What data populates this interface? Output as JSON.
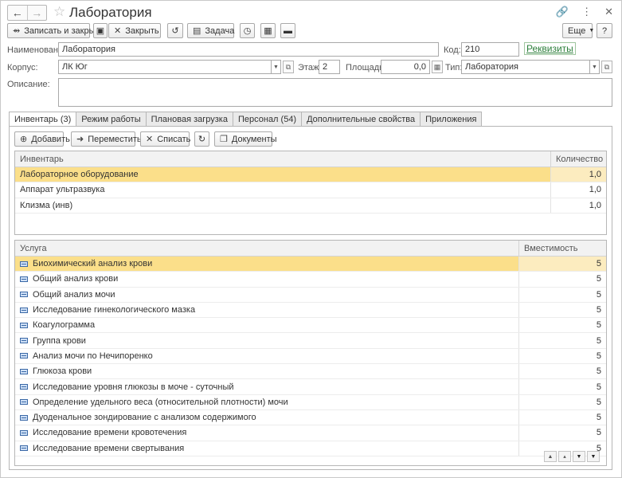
{
  "window": {
    "title": "Лаборатория"
  },
  "toolbar": {
    "save_close": "Записать и закрыть",
    "close": "Закрыть",
    "task": "Задача",
    "more": "Еще",
    "help": "?"
  },
  "form": {
    "name_label": "Наименование:",
    "name_value": "Лаборатория",
    "code_label": "Код:",
    "code_value": "210",
    "requisites_link": "Реквизиты",
    "building_label": "Корпус:",
    "building_value": "ЛК Юг",
    "floor_label": "Этаж:",
    "floor_value": "2",
    "area_label": "Площадь:",
    "area_value": "0,0",
    "type_label": "Тип:",
    "type_value": "Лаборатория",
    "description_label": "Описание:",
    "description_value": ""
  },
  "tabs": [
    {
      "label": "Инвентарь (3)",
      "active": true
    },
    {
      "label": "Режим работы",
      "active": false
    },
    {
      "label": "Плановая загрузка",
      "active": false
    },
    {
      "label": "Персонал (54)",
      "active": false
    },
    {
      "label": "Дополнительные свойства",
      "active": false
    },
    {
      "label": "Приложения",
      "active": false
    }
  ],
  "inventory_toolbar": {
    "add": "Добавить",
    "move": "Переместить",
    "write_off": "Списать",
    "documents": "Документы"
  },
  "inventory": {
    "columns": [
      "Инвентарь",
      "Количество"
    ],
    "rows": [
      {
        "name": "Лабораторное оборудование",
        "qty": "1,0",
        "selected": true
      },
      {
        "name": "Аппарат ультразвука",
        "qty": "1,0",
        "selected": false
      },
      {
        "name": "Клизма (инв)",
        "qty": "1,0",
        "selected": false
      }
    ]
  },
  "services": {
    "columns": [
      "Услуга",
      "Вместимость"
    ],
    "rows": [
      {
        "name": "Биохимический анализ крови",
        "capacity": "5",
        "selected": true
      },
      {
        "name": "Общий анализ крови",
        "capacity": "5",
        "selected": false
      },
      {
        "name": "Общий анализ мочи",
        "capacity": "5",
        "selected": false
      },
      {
        "name": "Исследование гинекологического мазка",
        "capacity": "5",
        "selected": false
      },
      {
        "name": "Коагулограмма",
        "capacity": "5",
        "selected": false
      },
      {
        "name": "Группа крови",
        "capacity": "5",
        "selected": false
      },
      {
        "name": "Анализ мочи по Нечипоренко",
        "capacity": "5",
        "selected": false
      },
      {
        "name": "Глюкоза крови",
        "capacity": "5",
        "selected": false
      },
      {
        "name": "Исследование уровня глюкозы в моче - суточный",
        "capacity": "5",
        "selected": false
      },
      {
        "name": "Определение удельного веса (относительной плотности) мочи",
        "capacity": "5",
        "selected": false
      },
      {
        "name": "Дуоденальное зондирование с анализом содержимого",
        "capacity": "5",
        "selected": false
      },
      {
        "name": "Исследование времени кровотечения",
        "capacity": "5",
        "selected": false
      },
      {
        "name": "Исследование времени свертывания",
        "capacity": "5",
        "selected": false
      }
    ]
  },
  "colors": {
    "selection": "#fbdf8a",
    "link": "#2b7f3a"
  }
}
